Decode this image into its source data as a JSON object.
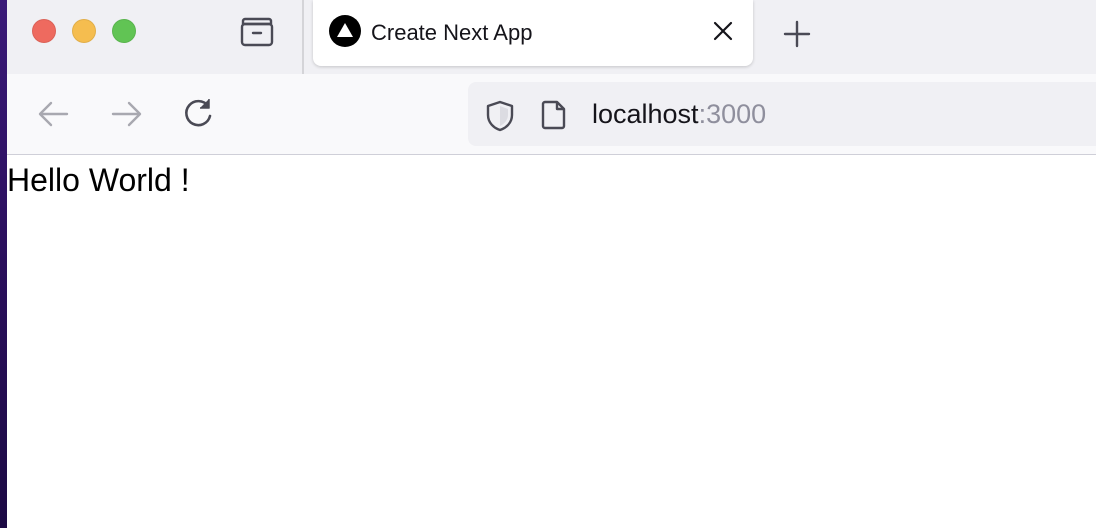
{
  "window": {
    "traffic_lights": {
      "close": "#ee6a5f",
      "minimize": "#f5bd4f",
      "maximize": "#61c454"
    }
  },
  "tabs": [
    {
      "title": "Create Next App",
      "favicon": "nextjs-triangle-icon",
      "active": true
    }
  ],
  "toolbar": {
    "icons": [
      "back-arrow-icon",
      "forward-arrow-icon",
      "reload-icon",
      "tab-list-icon",
      "new-tab-plus-icon",
      "close-x-icon"
    ]
  },
  "urlbar": {
    "host": "localhost",
    "port": ":3000",
    "icons": [
      "shield-icon",
      "page-icon"
    ]
  },
  "page": {
    "text": "Hello World !"
  },
  "colors": {
    "tabbar_bg": "#f0f0f4",
    "navbar_bg": "#f9f9fb",
    "urlbar_bg": "#f0f0f4",
    "text": "#15141a",
    "muted": "#8f8f9d"
  }
}
